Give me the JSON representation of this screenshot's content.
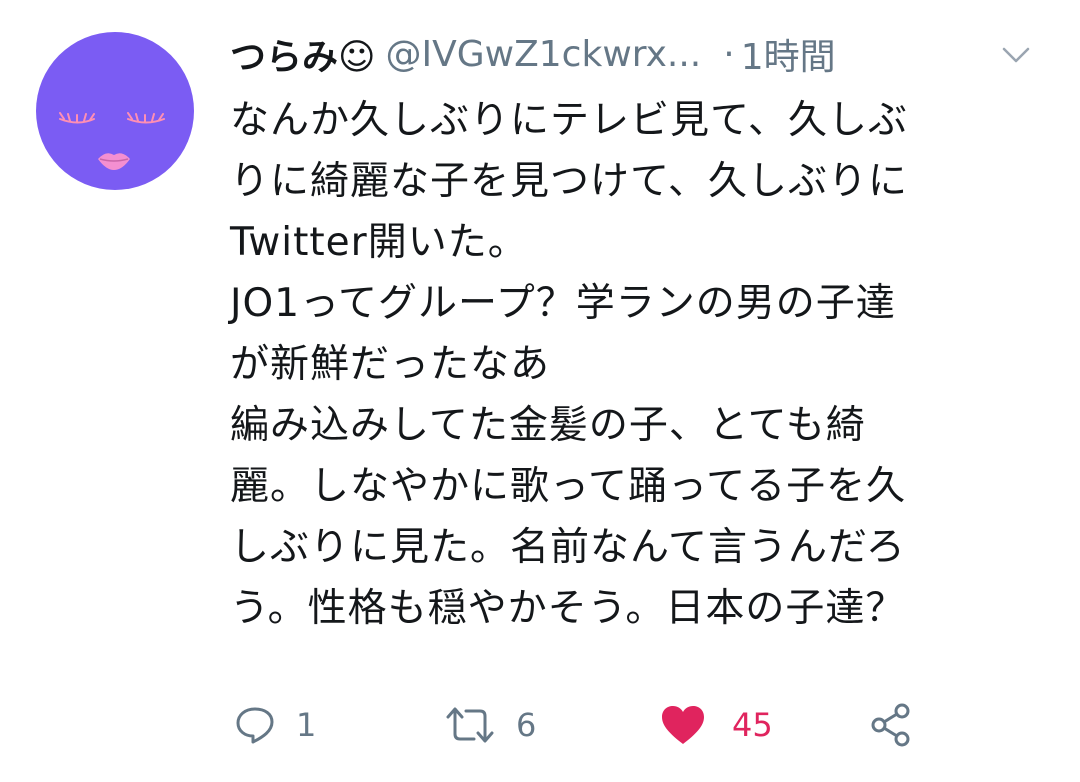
{
  "tweet": {
    "display_name": "つらみ☺",
    "handle": "@IVGwZ1ckwrx...",
    "separator": "·",
    "time": "1時間",
    "text_lines": [
      "なんか久しぶりにテレビ見て、久しぶ",
      "りに綺麗な子を見つけて、久しぶりに",
      "Twitter開いた。",
      "JO1ってグループ？学ランの男の子達",
      "が新鮮だったなあ",
      "編み込みしてた金髪の子、とても綺",
      "麗。しなやかに歌って踊ってる子を久",
      "しぶりに見た。名前なんて言うんだろ",
      "う。性格も穏やかそう。日本の子達？"
    ],
    "avatar_color": "#7b5cf3",
    "icons": {
      "caret": "chevron-down-icon",
      "reply": "reply-icon",
      "retweet": "retweet-icon",
      "like": "heart-icon",
      "share": "share-icon"
    },
    "actions": {
      "reply_count": "1",
      "retweet_count": "6",
      "like_count": "45"
    },
    "colors": {
      "text": "#14171a",
      "secondary": "#657786",
      "like": "#e0245e",
      "lips": "#f48fd1",
      "lashes": "#ff8fb3"
    }
  }
}
